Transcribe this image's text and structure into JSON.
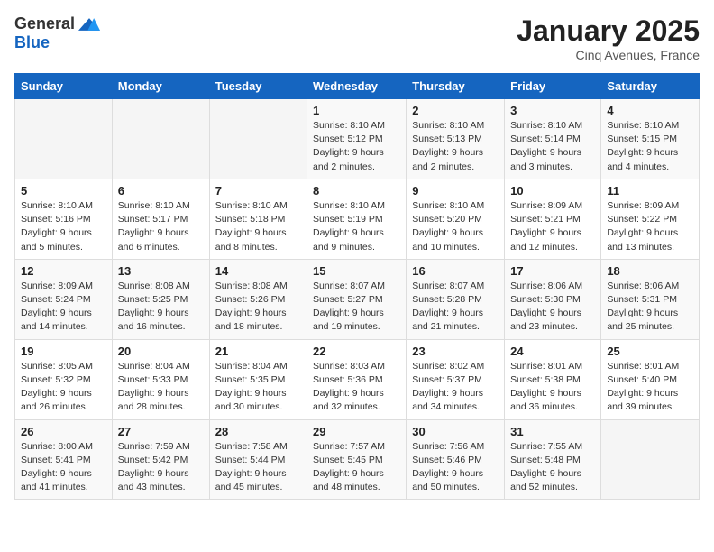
{
  "logo": {
    "general": "General",
    "blue": "Blue"
  },
  "header": {
    "title": "January 2025",
    "subtitle": "Cinq Avenues, France"
  },
  "weekdays": [
    "Sunday",
    "Monday",
    "Tuesday",
    "Wednesday",
    "Thursday",
    "Friday",
    "Saturday"
  ],
  "weeks": [
    [
      {
        "day": "",
        "info": ""
      },
      {
        "day": "",
        "info": ""
      },
      {
        "day": "",
        "info": ""
      },
      {
        "day": "1",
        "info": "Sunrise: 8:10 AM\nSunset: 5:12 PM\nDaylight: 9 hours\nand 2 minutes."
      },
      {
        "day": "2",
        "info": "Sunrise: 8:10 AM\nSunset: 5:13 PM\nDaylight: 9 hours\nand 2 minutes."
      },
      {
        "day": "3",
        "info": "Sunrise: 8:10 AM\nSunset: 5:14 PM\nDaylight: 9 hours\nand 3 minutes."
      },
      {
        "day": "4",
        "info": "Sunrise: 8:10 AM\nSunset: 5:15 PM\nDaylight: 9 hours\nand 4 minutes."
      }
    ],
    [
      {
        "day": "5",
        "info": "Sunrise: 8:10 AM\nSunset: 5:16 PM\nDaylight: 9 hours\nand 5 minutes."
      },
      {
        "day": "6",
        "info": "Sunrise: 8:10 AM\nSunset: 5:17 PM\nDaylight: 9 hours\nand 6 minutes."
      },
      {
        "day": "7",
        "info": "Sunrise: 8:10 AM\nSunset: 5:18 PM\nDaylight: 9 hours\nand 8 minutes."
      },
      {
        "day": "8",
        "info": "Sunrise: 8:10 AM\nSunset: 5:19 PM\nDaylight: 9 hours\nand 9 minutes."
      },
      {
        "day": "9",
        "info": "Sunrise: 8:10 AM\nSunset: 5:20 PM\nDaylight: 9 hours\nand 10 minutes."
      },
      {
        "day": "10",
        "info": "Sunrise: 8:09 AM\nSunset: 5:21 PM\nDaylight: 9 hours\nand 12 minutes."
      },
      {
        "day": "11",
        "info": "Sunrise: 8:09 AM\nSunset: 5:22 PM\nDaylight: 9 hours\nand 13 minutes."
      }
    ],
    [
      {
        "day": "12",
        "info": "Sunrise: 8:09 AM\nSunset: 5:24 PM\nDaylight: 9 hours\nand 14 minutes."
      },
      {
        "day": "13",
        "info": "Sunrise: 8:08 AM\nSunset: 5:25 PM\nDaylight: 9 hours\nand 16 minutes."
      },
      {
        "day": "14",
        "info": "Sunrise: 8:08 AM\nSunset: 5:26 PM\nDaylight: 9 hours\nand 18 minutes."
      },
      {
        "day": "15",
        "info": "Sunrise: 8:07 AM\nSunset: 5:27 PM\nDaylight: 9 hours\nand 19 minutes."
      },
      {
        "day": "16",
        "info": "Sunrise: 8:07 AM\nSunset: 5:28 PM\nDaylight: 9 hours\nand 21 minutes."
      },
      {
        "day": "17",
        "info": "Sunrise: 8:06 AM\nSunset: 5:30 PM\nDaylight: 9 hours\nand 23 minutes."
      },
      {
        "day": "18",
        "info": "Sunrise: 8:06 AM\nSunset: 5:31 PM\nDaylight: 9 hours\nand 25 minutes."
      }
    ],
    [
      {
        "day": "19",
        "info": "Sunrise: 8:05 AM\nSunset: 5:32 PM\nDaylight: 9 hours\nand 26 minutes."
      },
      {
        "day": "20",
        "info": "Sunrise: 8:04 AM\nSunset: 5:33 PM\nDaylight: 9 hours\nand 28 minutes."
      },
      {
        "day": "21",
        "info": "Sunrise: 8:04 AM\nSunset: 5:35 PM\nDaylight: 9 hours\nand 30 minutes."
      },
      {
        "day": "22",
        "info": "Sunrise: 8:03 AM\nSunset: 5:36 PM\nDaylight: 9 hours\nand 32 minutes."
      },
      {
        "day": "23",
        "info": "Sunrise: 8:02 AM\nSunset: 5:37 PM\nDaylight: 9 hours\nand 34 minutes."
      },
      {
        "day": "24",
        "info": "Sunrise: 8:01 AM\nSunset: 5:38 PM\nDaylight: 9 hours\nand 36 minutes."
      },
      {
        "day": "25",
        "info": "Sunrise: 8:01 AM\nSunset: 5:40 PM\nDaylight: 9 hours\nand 39 minutes."
      }
    ],
    [
      {
        "day": "26",
        "info": "Sunrise: 8:00 AM\nSunset: 5:41 PM\nDaylight: 9 hours\nand 41 minutes."
      },
      {
        "day": "27",
        "info": "Sunrise: 7:59 AM\nSunset: 5:42 PM\nDaylight: 9 hours\nand 43 minutes."
      },
      {
        "day": "28",
        "info": "Sunrise: 7:58 AM\nSunset: 5:44 PM\nDaylight: 9 hours\nand 45 minutes."
      },
      {
        "day": "29",
        "info": "Sunrise: 7:57 AM\nSunset: 5:45 PM\nDaylight: 9 hours\nand 48 minutes."
      },
      {
        "day": "30",
        "info": "Sunrise: 7:56 AM\nSunset: 5:46 PM\nDaylight: 9 hours\nand 50 minutes."
      },
      {
        "day": "31",
        "info": "Sunrise: 7:55 AM\nSunset: 5:48 PM\nDaylight: 9 hours\nand 52 minutes."
      },
      {
        "day": "",
        "info": ""
      }
    ]
  ]
}
